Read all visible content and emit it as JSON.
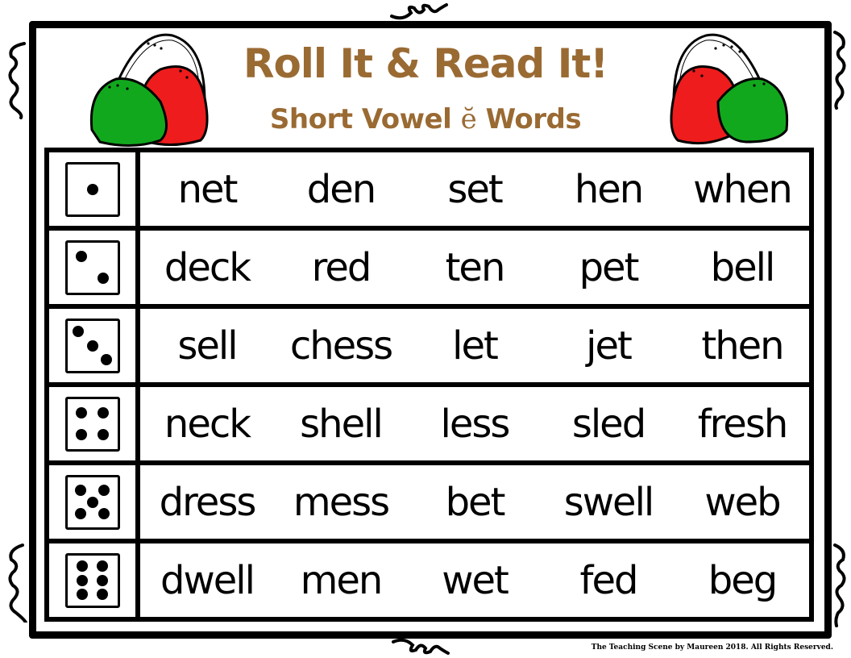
{
  "header": {
    "title": "Roll It & Read It!",
    "subtitle_prefix": "Short Vowel ",
    "subtitle_vowel": "ĕ",
    "subtitle_suffix": " Words",
    "title_color": "#9a6a33"
  },
  "colors": {
    "gumdrop_red": "#ee1c1c",
    "gumdrop_green": "#12a81e",
    "border": "#000000"
  },
  "rows": [
    {
      "die": 1,
      "words": [
        "net",
        "den",
        "set",
        "hen",
        "when"
      ]
    },
    {
      "die": 2,
      "words": [
        "deck",
        "red",
        "ten",
        "pet",
        "bell"
      ]
    },
    {
      "die": 3,
      "words": [
        "sell",
        "chess",
        "let",
        "jet",
        "then"
      ]
    },
    {
      "die": 4,
      "words": [
        "neck",
        "shell",
        "less",
        "sled",
        "fresh"
      ]
    },
    {
      "die": 5,
      "words": [
        "dress",
        "mess",
        "bet",
        "swell",
        "web"
      ]
    },
    {
      "die": 6,
      "words": [
        "dwell",
        "men",
        "wet",
        "fed",
        "beg"
      ]
    }
  ],
  "icons": {
    "die_faces": [
      "die-one-icon",
      "die-two-icon",
      "die-three-icon",
      "die-four-icon",
      "die-five-icon",
      "die-six-icon"
    ],
    "left_gumdrops": "gumdrops-icon",
    "right_gumdrops": "gumdrops-icon"
  },
  "footer": {
    "copyright": "The Teaching Scene by Maureen 2018. All Rights Reserved."
  }
}
